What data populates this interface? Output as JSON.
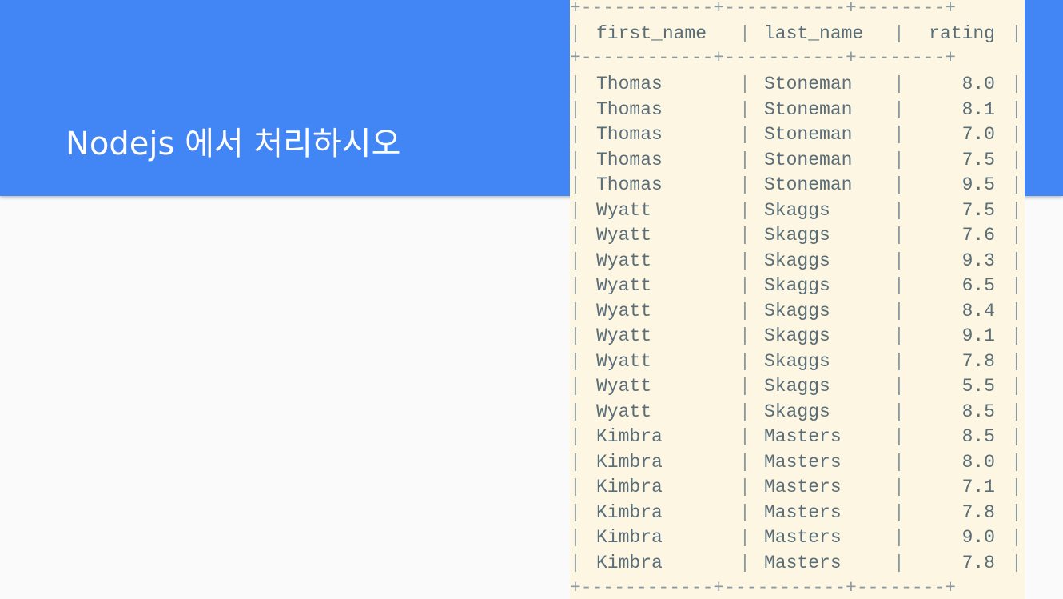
{
  "slide": {
    "title": "Nodejs 에서 처리하시오"
  },
  "table": {
    "separator": "+------------+-----------+--------+",
    "pipe": "|",
    "headers": [
      "first_name",
      "last_name",
      "rating"
    ],
    "rows": [
      [
        "Thomas",
        "Stoneman",
        "8.0"
      ],
      [
        "Thomas",
        "Stoneman",
        "8.1"
      ],
      [
        "Thomas",
        "Stoneman",
        "7.0"
      ],
      [
        "Thomas",
        "Stoneman",
        "7.5"
      ],
      [
        "Thomas",
        "Stoneman",
        "9.5"
      ],
      [
        "Wyatt",
        "Skaggs",
        "7.5"
      ],
      [
        "Wyatt",
        "Skaggs",
        "7.6"
      ],
      [
        "Wyatt",
        "Skaggs",
        "9.3"
      ],
      [
        "Wyatt",
        "Skaggs",
        "6.5"
      ],
      [
        "Wyatt",
        "Skaggs",
        "8.4"
      ],
      [
        "Wyatt",
        "Skaggs",
        "9.1"
      ],
      [
        "Wyatt",
        "Skaggs",
        "7.8"
      ],
      [
        "Wyatt",
        "Skaggs",
        "5.5"
      ],
      [
        "Wyatt",
        "Skaggs",
        "8.5"
      ],
      [
        "Kimbra",
        "Masters",
        "8.5"
      ],
      [
        "Kimbra",
        "Masters",
        "8.0"
      ],
      [
        "Kimbra",
        "Masters",
        "7.1"
      ],
      [
        "Kimbra",
        "Masters",
        "7.8"
      ],
      [
        "Kimbra",
        "Masters",
        "9.0"
      ],
      [
        "Kimbra",
        "Masters",
        "7.8"
      ]
    ]
  },
  "colors": {
    "header_band": "#4285f4",
    "table_background": "#fdf6e3",
    "table_text": "#5a6e78",
    "page_background": "#fafafa"
  }
}
